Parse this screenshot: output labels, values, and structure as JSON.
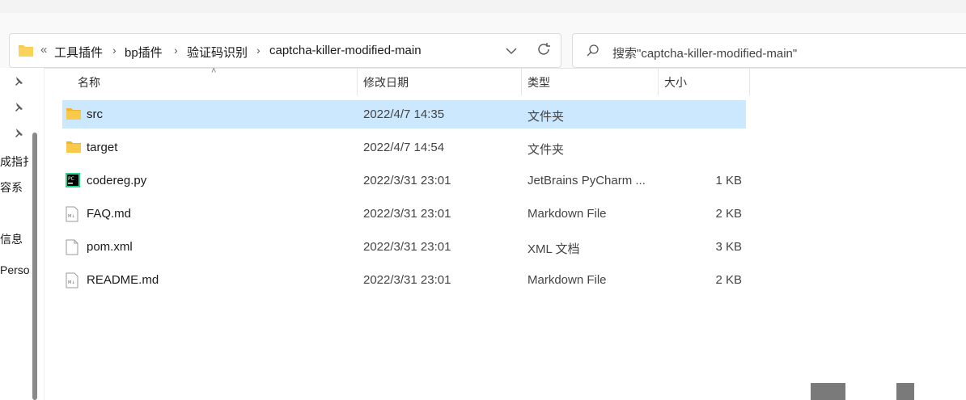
{
  "address_bar": {
    "overflow_glyph": "«",
    "breadcrumbs": [
      "工具插件",
      "bp插件",
      "验证码识别",
      "captcha-killer-modified-main"
    ],
    "separator": "›"
  },
  "search": {
    "placeholder": "搜索\"captcha-killer-modified-main\""
  },
  "nav_pane": {
    "items": [
      "成指扌",
      "容系",
      "信息",
      "Perso"
    ]
  },
  "columns": {
    "name": "名称",
    "date": "修改日期",
    "type": "类型",
    "size": "大小"
  },
  "files": [
    {
      "name": "src",
      "date": "2022/4/7 14:35",
      "type": "文件夹",
      "size": "",
      "icon": "folder-icon",
      "selected": true
    },
    {
      "name": "target",
      "date": "2022/4/7 14:54",
      "type": "文件夹",
      "size": "",
      "icon": "folder-icon",
      "selected": false
    },
    {
      "name": "codereg.py",
      "date": "2022/3/31 23:01",
      "type": "JetBrains PyCharm ...",
      "size": "1 KB",
      "icon": "pycharm-file-icon",
      "selected": false
    },
    {
      "name": "FAQ.md",
      "date": "2022/3/31 23:01",
      "type": "Markdown File",
      "size": "2 KB",
      "icon": "markdown-file-icon",
      "selected": false
    },
    {
      "name": "pom.xml",
      "date": "2022/3/31 23:01",
      "type": "XML 文档",
      "size": "3 KB",
      "icon": "document-file-icon",
      "selected": false
    },
    {
      "name": "README.md",
      "date": "2022/3/31 23:01",
      "type": "Markdown File",
      "size": "2 KB",
      "icon": "markdown-file-icon",
      "selected": false
    }
  ],
  "colors": {
    "selection": "#cce8ff",
    "folder": "#f8c94a",
    "accent_gray": "#7a7a7a"
  }
}
